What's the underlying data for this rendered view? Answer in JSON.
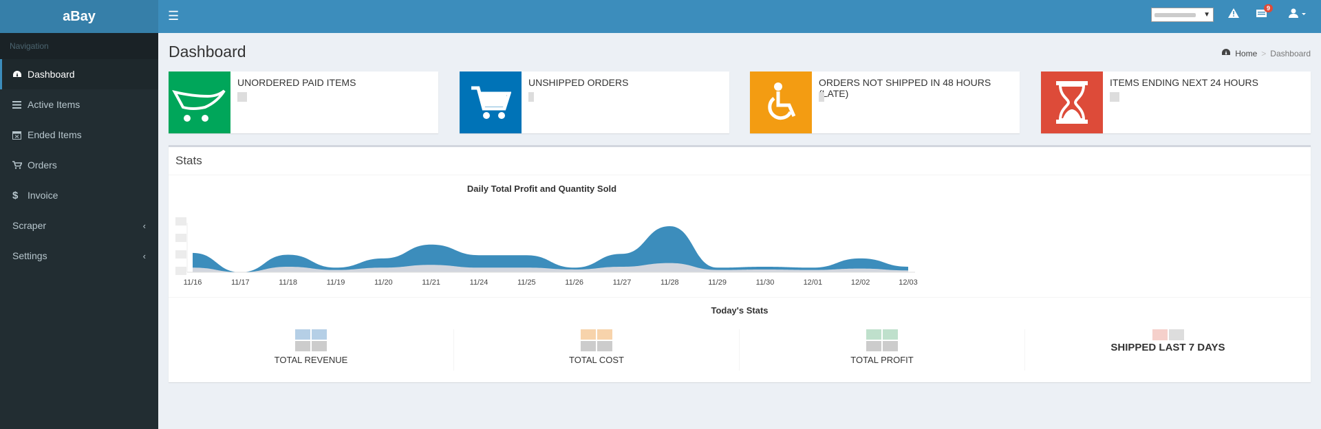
{
  "app": {
    "title": "aBay"
  },
  "topbar": {
    "notifications_count": "9"
  },
  "sidebar": {
    "header": "Navigation",
    "items": [
      {
        "label": "Dashboard",
        "icon": "dashboard-icon"
      },
      {
        "label": "Active Items",
        "icon": "list-icon"
      },
      {
        "label": "Ended Items",
        "icon": "calendar-x-icon"
      },
      {
        "label": "Orders",
        "icon": "cart-icon"
      },
      {
        "label": "Invoice",
        "icon": "dollar-icon"
      },
      {
        "label": "Scraper",
        "icon": "chevron-left-icon"
      },
      {
        "label": "Settings",
        "icon": "chevron-left-icon"
      }
    ]
  },
  "page": {
    "title": "Dashboard",
    "breadcrumb": {
      "home": "Home",
      "current": "Dashboard"
    }
  },
  "info_boxes": [
    {
      "label": "UNORDERED PAID ITEMS",
      "color": "#00a65a",
      "icon": "opencart-icon"
    },
    {
      "label": "UNSHIPPED ORDERS",
      "color": "#0073b7",
      "icon": "shopping-cart-icon"
    },
    {
      "label": "ORDERS NOT SHIPPED IN 48 HOURS (LATE)",
      "color": "#f39c12",
      "icon": "wheelchair-icon"
    },
    {
      "label": "ITEMS ENDING NEXT 24 HOURS",
      "color": "#dd4b39",
      "icon": "hourglass-icon"
    }
  ],
  "stats": {
    "title": "Stats",
    "today_title": "Today's Stats",
    "columns": [
      {
        "label": "TOTAL REVENUE",
        "color": "#3c8dbc"
      },
      {
        "label": "TOTAL COST",
        "color": "#f39c12"
      },
      {
        "label": "TOTAL PROFIT",
        "color": "#00a65a"
      },
      {
        "label": "SHIPPED LAST 7 DAYS",
        "color": "#dd4b39"
      }
    ]
  },
  "chart_data": {
    "type": "area",
    "title": "Daily Total Profit and Quantity Sold",
    "categories": [
      "11/16",
      "11/17",
      "11/18",
      "11/19",
      "11/20",
      "11/21",
      "11/24",
      "11/25",
      "11/26",
      "11/27",
      "11/28",
      "11/29",
      "11/30",
      "12/01",
      "12/02",
      "12/03"
    ],
    "series": [
      {
        "color": "#3c8dbc",
        "values": [
          0.42,
          0.0,
          0.38,
          0.1,
          0.3,
          0.6,
          0.37,
          0.37,
          0.1,
          0.4,
          1.0,
          0.1,
          0.12,
          0.1,
          0.3,
          0.12
        ]
      },
      {
        "color": "#d2d6de",
        "values": [
          0.1,
          0.0,
          0.12,
          0.05,
          0.1,
          0.16,
          0.1,
          0.1,
          0.06,
          0.12,
          0.2,
          0.05,
          0.06,
          0.05,
          0.08,
          0.04
        ]
      }
    ],
    "grid": false
  }
}
